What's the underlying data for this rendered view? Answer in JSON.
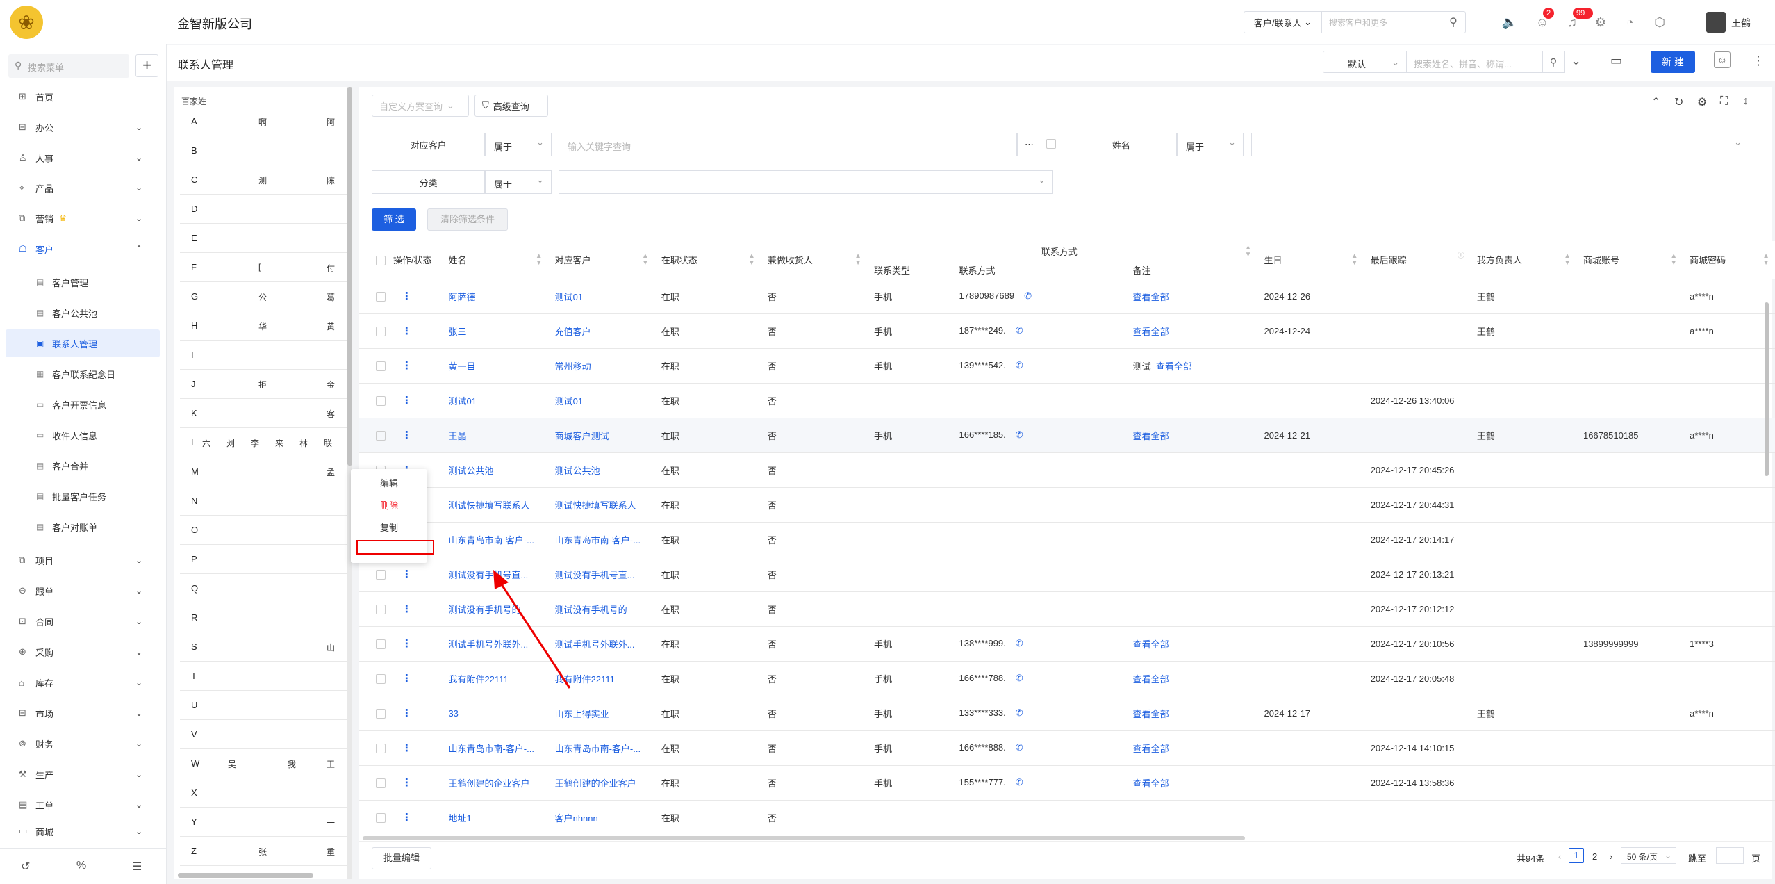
{
  "header": {
    "company": "金智新版公司",
    "search_scope": "客户/联系人",
    "search_placeholder": "搜索客户和更多",
    "badge_messages": "2",
    "badge_notifications": "99+",
    "user_name": "王鹤"
  },
  "sidebar": {
    "search_placeholder": "搜索菜单",
    "items": [
      {
        "label": "首页",
        "icon": "home-icon"
      },
      {
        "label": "办公",
        "icon": "office-icon"
      },
      {
        "label": "人事",
        "icon": "person-icon"
      },
      {
        "label": "产品",
        "icon": "product-icon"
      },
      {
        "label": "营销",
        "icon": "marketing-icon"
      },
      {
        "label": "客户",
        "icon": "customer-icon"
      }
    ],
    "sub_items": [
      "客户管理",
      "客户公共池",
      "联系人管理",
      "客户联系纪念日",
      "客户开票信息",
      "收件人信息",
      "客户合并",
      "批量客户任务",
      "客户对账单"
    ],
    "items2": [
      "项目",
      "跟单",
      "合同",
      "采购",
      "库存",
      "市场",
      "财务",
      "生产",
      "工单",
      "商城"
    ]
  },
  "page": {
    "title": "联系人管理",
    "view_select": "默认",
    "search_placeholder": "搜索姓名、拼音、称谓...",
    "new_button": "新 建"
  },
  "alphabet": {
    "title": "百家姓",
    "rows": [
      {
        "letter": "A",
        "names": [
          "啊",
          "阿"
        ]
      },
      {
        "letter": "B",
        "names": []
      },
      {
        "letter": "C",
        "names": [
          "测",
          "陈"
        ]
      },
      {
        "letter": "D",
        "names": []
      },
      {
        "letter": "E",
        "names": []
      },
      {
        "letter": "F",
        "names": [
          "[",
          "付"
        ]
      },
      {
        "letter": "G",
        "names": [
          "公",
          "葛"
        ]
      },
      {
        "letter": "H",
        "names": [
          "华",
          "黄"
        ]
      },
      {
        "letter": "I",
        "names": []
      },
      {
        "letter": "J",
        "names": [
          "拒",
          "金"
        ]
      },
      {
        "letter": "K",
        "names": [
          "客"
        ]
      },
      {
        "letter": "L",
        "names": [
          "六",
          "刘",
          "李",
          "来",
          "林",
          "联"
        ]
      },
      {
        "letter": "M",
        "names": [
          "孟"
        ]
      },
      {
        "letter": "N",
        "names": []
      },
      {
        "letter": "O",
        "names": []
      },
      {
        "letter": "P",
        "names": []
      },
      {
        "letter": "Q",
        "names": []
      },
      {
        "letter": "R",
        "names": []
      },
      {
        "letter": "S",
        "names": [
          "山"
        ]
      },
      {
        "letter": "T",
        "names": []
      },
      {
        "letter": "U",
        "names": []
      },
      {
        "letter": "V",
        "names": []
      },
      {
        "letter": "W",
        "names": [
          "吴",
          "我",
          "王"
        ]
      },
      {
        "letter": "X",
        "names": []
      },
      {
        "letter": "Y",
        "names": [
          "一"
        ]
      },
      {
        "letter": "Z",
        "names": [
          "张",
          "重"
        ]
      }
    ]
  },
  "filters": {
    "custom_placeholder": "自定义方案查询",
    "advanced": "高级查询",
    "f1_label": "对应客户",
    "f1_op": "属于",
    "f1_placeholder": "输入关键字查询",
    "f2_label": "姓名",
    "f2_op": "属于",
    "f3_label": "分类",
    "f3_op": "属于",
    "filter_button": "筛 选",
    "clear_button": "清除筛选条件"
  },
  "table": {
    "group_header": "联系方式",
    "headers": [
      "操作/状态",
      "姓名",
      "对应客户",
      "在职状态",
      "兼做收货人",
      "联系类型",
      "联系方式",
      "备注",
      "生日",
      "最后跟踪",
      "我方负责人",
      "商城账号",
      "商城密码"
    ],
    "rows": [
      {
        "name": "阿萨德",
        "cust": "测试01",
        "st": "在职",
        "recv": "否",
        "type": "手机",
        "phone": "17890987689",
        "note_pre": "",
        "note": "查看全部",
        "bday": "2024-12-26",
        "last": "",
        "owner": "王鹤",
        "acct": "",
        "pwd": "a****n"
      },
      {
        "name": "张三",
        "cust": "充值客户",
        "st": "在职",
        "recv": "否",
        "type": "手机",
        "phone": "187****249.",
        "note_pre": "",
        "note": "查看全部",
        "bday": "2024-12-24",
        "last": "",
        "owner": "王鹤",
        "acct": "",
        "pwd": "a****n"
      },
      {
        "name": "黄一目",
        "cust": "常州移动",
        "st": "在职",
        "recv": "否",
        "type": "手机",
        "phone": "139****542.",
        "note_pre": "测试",
        "note": "查看全部",
        "bday": "",
        "last": "",
        "owner": "",
        "acct": "",
        "pwd": ""
      },
      {
        "name": "测试01",
        "cust": "测试01",
        "st": "在职",
        "recv": "否",
        "type": "",
        "phone": "",
        "note_pre": "",
        "note": "",
        "bday": "",
        "last": "2024-12-26 13:40:06",
        "owner": "",
        "acct": "",
        "pwd": ""
      },
      {
        "name": "王晶",
        "cust": "商城客户测试",
        "st": "在职",
        "recv": "否",
        "type": "手机",
        "phone": "166****185.",
        "note_pre": "",
        "note": "查看全部",
        "bday": "2024-12-21",
        "last": "",
        "owner": "王鹤",
        "acct": "16678510185",
        "pwd": "a****n"
      },
      {
        "name": "测试公共池",
        "cust": "测试公共池",
        "st": "在职",
        "recv": "否",
        "type": "",
        "phone": "",
        "note_pre": "",
        "note": "",
        "bday": "",
        "last": "2024-12-17 20:45:26",
        "owner": "",
        "acct": "",
        "pwd": ""
      },
      {
        "name": "测试快捷填写联系人",
        "cust": "测试快捷填写联系人",
        "st": "在职",
        "recv": "否",
        "type": "",
        "phone": "",
        "note_pre": "",
        "note": "",
        "bday": "",
        "last": "2024-12-17 20:44:31",
        "owner": "",
        "acct": "",
        "pwd": ""
      },
      {
        "name": "山东青岛市南-客户-...",
        "cust": "山东青岛市南-客户-...",
        "st": "在职",
        "recv": "否",
        "type": "",
        "phone": "",
        "note_pre": "",
        "note": "",
        "bday": "",
        "last": "2024-12-17 20:14:17",
        "owner": "",
        "acct": "",
        "pwd": ""
      },
      {
        "name": "测试没有手机号直...",
        "cust": "测试没有手机号直...",
        "st": "在职",
        "recv": "否",
        "type": "",
        "phone": "",
        "note_pre": "",
        "note": "",
        "bday": "",
        "last": "2024-12-17 20:13:21",
        "owner": "",
        "acct": "",
        "pwd": ""
      },
      {
        "name": "测试没有手机号的",
        "cust": "测试没有手机号的",
        "st": "在职",
        "recv": "否",
        "type": "",
        "phone": "",
        "note_pre": "",
        "note": "",
        "bday": "",
        "last": "2024-12-17 20:12:12",
        "owner": "",
        "acct": "",
        "pwd": ""
      },
      {
        "name": "测试手机号外联外...",
        "cust": "测试手机号外联外...",
        "st": "在职",
        "recv": "否",
        "type": "手机",
        "phone": "138****999.",
        "note_pre": "",
        "note": "查看全部",
        "bday": "",
        "last": "2024-12-17 20:10:56",
        "owner": "",
        "acct": "13899999999",
        "pwd": "1****3"
      },
      {
        "name": "我有附件22111",
        "cust": "我有附件22111",
        "st": "在职",
        "recv": "否",
        "type": "手机",
        "phone": "166****788.",
        "note_pre": "",
        "note": "查看全部",
        "bday": "",
        "last": "2024-12-17 20:05:48",
        "owner": "",
        "acct": "",
        "pwd": ""
      },
      {
        "name": "33",
        "cust": "山东上得实业",
        "st": "在职",
        "recv": "否",
        "type": "手机",
        "phone": "133****333.",
        "note_pre": "",
        "note": "查看全部",
        "bday": "2024-12-17",
        "last": "",
        "owner": "王鹤",
        "acct": "",
        "pwd": "a****n"
      },
      {
        "name": "山东青岛市南-客户-...",
        "cust": "山东青岛市南-客户-...",
        "st": "在职",
        "recv": "否",
        "type": "手机",
        "phone": "166****888.",
        "note_pre": "",
        "note": "查看全部",
        "bday": "",
        "last": "2024-12-14 14:10:15",
        "owner": "",
        "acct": "",
        "pwd": ""
      },
      {
        "name": "王鹤创建的企业客户",
        "cust": "王鹤创建的企业客户",
        "st": "在职",
        "recv": "否",
        "type": "手机",
        "phone": "155****777.",
        "note_pre": "",
        "note": "查看全部",
        "bday": "",
        "last": "2024-12-14 13:58:36",
        "owner": "",
        "acct": "",
        "pwd": ""
      },
      {
        "name": "地址1",
        "cust": "客户nhnnn",
        "st": "在职",
        "recv": "否",
        "type": "",
        "phone": "",
        "note_pre": "",
        "note": "",
        "bday": "",
        "last": "",
        "owner": "",
        "acct": "",
        "pwd": ""
      }
    ]
  },
  "context_menu": {
    "edit": "编辑",
    "delete": "删除",
    "copy": "复制",
    "highlighted": ""
  },
  "footer": {
    "batch_edit": "批量编辑",
    "total": "共94条",
    "page1": "1",
    "page2": "2",
    "page_size": "50 条/页",
    "jump_label": "跳至",
    "page_unit": "页"
  },
  "colors": {
    "primary": "#1d5fe0",
    "danger": "#f5222d"
  }
}
